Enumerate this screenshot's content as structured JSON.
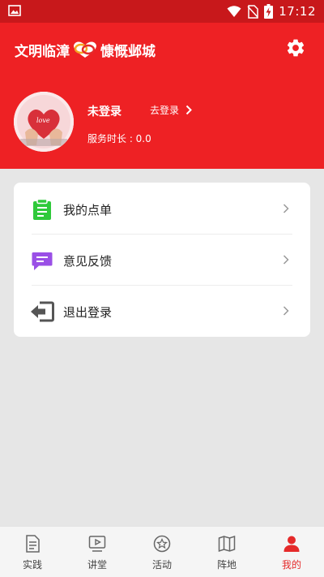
{
  "status_bar": {
    "time": "17:12"
  },
  "header": {
    "title_left": "文明临漳",
    "title_right": "慷慨邺城",
    "username": "未登录",
    "login_label": "去登录",
    "service_time": "服务时长 : 0.0",
    "avatar_text": "love"
  },
  "menu": {
    "items": [
      {
        "label": "我的点单",
        "icon": "clipboard-icon"
      },
      {
        "label": "意见反馈",
        "icon": "feedback-icon"
      },
      {
        "label": "退出登录",
        "icon": "logout-icon"
      }
    ]
  },
  "tabbar": {
    "items": [
      {
        "label": "实践",
        "icon": "document-icon"
      },
      {
        "label": "讲堂",
        "icon": "video-icon"
      },
      {
        "label": "活动",
        "icon": "star-icon"
      },
      {
        "label": "阵地",
        "icon": "map-icon"
      },
      {
        "label": "我的",
        "icon": "person-icon"
      }
    ],
    "active": "我的"
  },
  "colors": {
    "header_red": "#ee2124",
    "status_red": "#c8181b",
    "active_tab": "#e52a2a",
    "clipboard_green": "#2fc93a",
    "feedback_purple": "#9a4fe6"
  }
}
